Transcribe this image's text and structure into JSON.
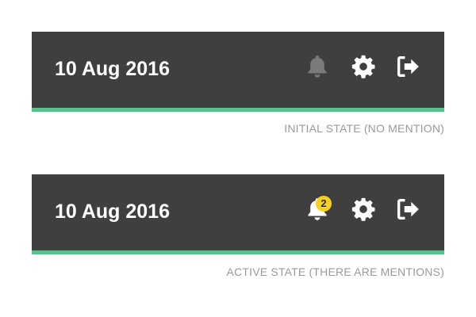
{
  "colors": {
    "bar_background": "#3f3f3f",
    "bar_accent": "#5bbf8d",
    "text": "#ffffff",
    "bell_inactive": "#7a7a7a",
    "badge": "#f6d21f",
    "caption": "#9a9a9a"
  },
  "states": [
    {
      "date": "10 Aug 2016",
      "icons": [
        "bell-icon",
        "gear-icon",
        "logout-icon"
      ],
      "bell_active": false,
      "badge_count": null,
      "caption": "INITIAL STATE (NO MENTION)"
    },
    {
      "date": "10 Aug 2016",
      "icons": [
        "bell-icon",
        "gear-icon",
        "logout-icon"
      ],
      "bell_active": true,
      "badge_count": "2",
      "caption": "ACTIVE STATE (THERE ARE MENTIONS)"
    }
  ]
}
